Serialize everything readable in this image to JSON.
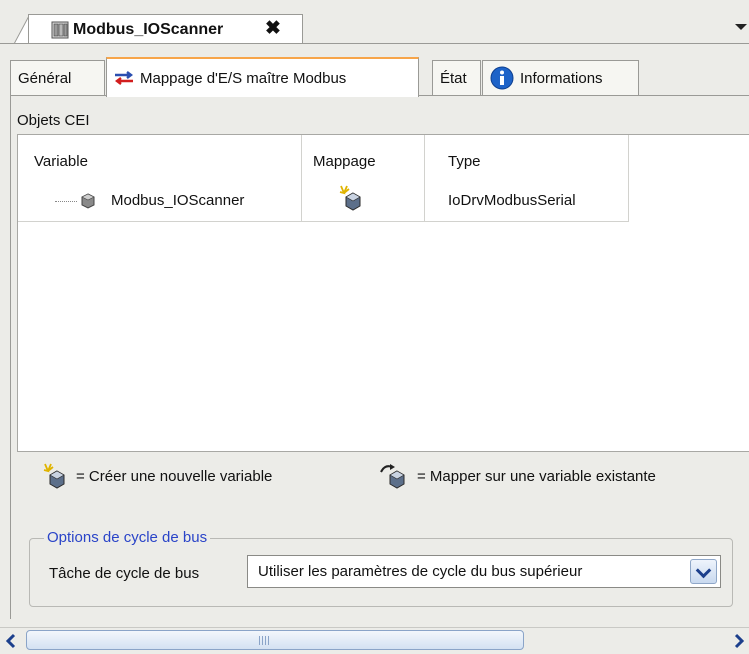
{
  "document_tab": {
    "title": "Modbus_IOScanner",
    "close_label": "✖"
  },
  "tabs": [
    {
      "label": "Général"
    },
    {
      "label": "Mappage d'E/S maître Modbus"
    },
    {
      "label": "État"
    },
    {
      "label": "Informations"
    }
  ],
  "section": {
    "label": "Objets CEI"
  },
  "table": {
    "columns": [
      "Variable",
      "Mappage",
      "Type"
    ],
    "rows": [
      {
        "variable": "Modbus_IOScanner",
        "type": "IoDrvModbusSerial"
      }
    ]
  },
  "legend": {
    "create": "= Créer une nouvelle variable",
    "map": "= Mapper sur une variable existante"
  },
  "bus_cycle": {
    "group_title": "Options de cycle de bus",
    "field_label": "Tâche de cycle de bus",
    "selected": "Utiliser les paramètres de cycle du bus supérieur"
  },
  "colors": {
    "active_tab_accent": "#f7a54a",
    "group_title": "#2a44c8"
  }
}
